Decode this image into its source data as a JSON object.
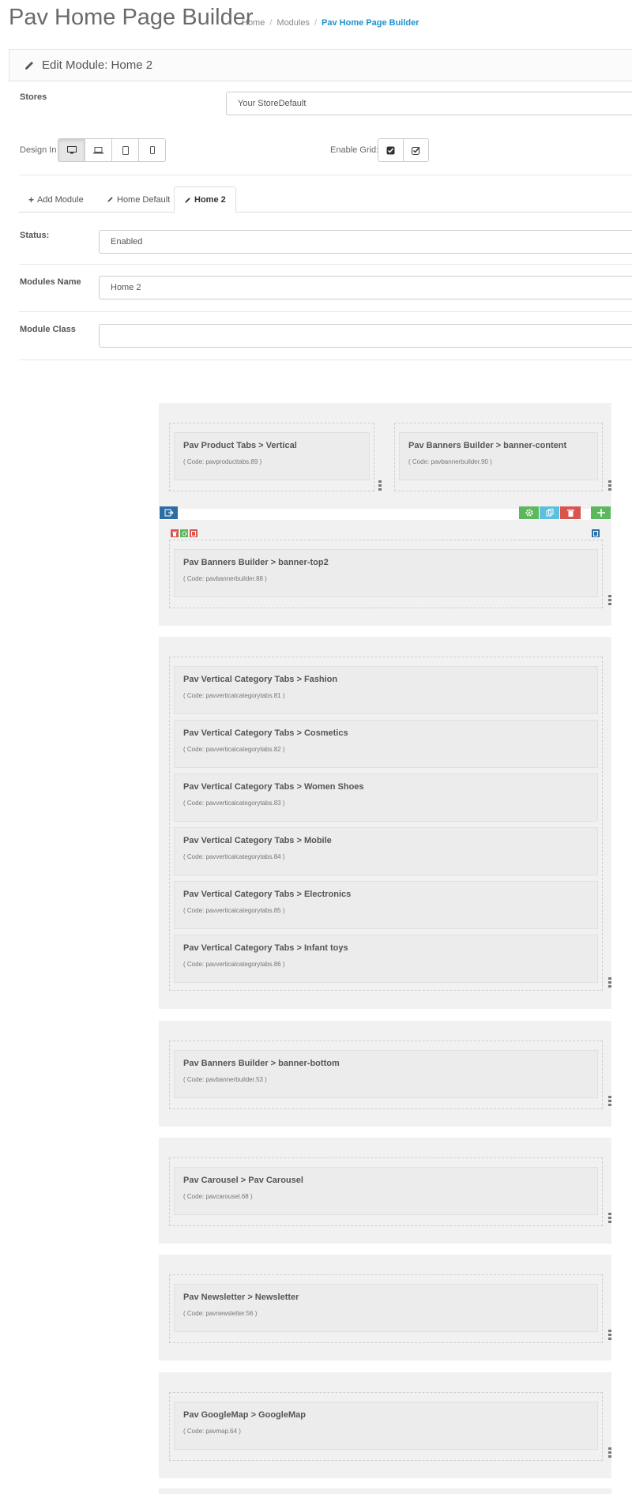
{
  "header": {
    "title": "Pav Home Page Builder",
    "breadcrumb": [
      "Home",
      "Modules",
      "Pav Home Page Builder"
    ]
  },
  "panel": {
    "title": "Edit Module: Home 2"
  },
  "form": {
    "stores_label": "Stores",
    "stores_value": "Your StoreDefault",
    "design_in_label": "Design In",
    "enable_grid_label": "Enable Grid:"
  },
  "tabs": [
    {
      "label": "Add Module",
      "icon": "plus-icon"
    },
    {
      "label": "Home Default",
      "icon": "pencil-icon"
    },
    {
      "label": "Home 2",
      "icon": "pencil-icon",
      "active": true
    }
  ],
  "fields": {
    "status_label": "Status:",
    "status_value": "Enabled",
    "name_label": "Modules Name",
    "name_value": "Home 2",
    "class_label": "Module Class",
    "class_value": ""
  },
  "colors": {
    "accent": "#1e91cf",
    "green": "#5cb85c",
    "teal": "#5bc0de",
    "red": "#d9534f",
    "blue": "#2e6da4"
  },
  "layout_rows": [
    {
      "widgets": [
        {
          "name": "Pav Product Tabs > Vertical",
          "code": "( Code: pavproducttabs.89 )"
        },
        {
          "name": "Pav Banners Builder > banner-content",
          "code": "( Code: pavbannerbuilder.90 )"
        }
      ]
    },
    {
      "widgets": [
        {
          "name": "Pav Banners Builder > banner-top2",
          "code": "( Code: pavbannerbuilder.88 )"
        }
      ]
    },
    {
      "widgets": [
        {
          "name": "Pav Vertical Category Tabs > Fashion",
          "code": "( Code: pavverticalcategorytabs.81 )"
        },
        {
          "name": "Pav Vertical Category Tabs > Cosmetics",
          "code": "( Code: pavverticalcategorytabs.82 )"
        },
        {
          "name": "Pav Vertical Category Tabs > Women Shoes",
          "code": "( Code: pavverticalcategorytabs.83 )"
        },
        {
          "name": "Pav Vertical Category Tabs > Mobile",
          "code": "( Code: pavverticalcategorytabs.84 )"
        },
        {
          "name": "Pav Vertical Category Tabs > Electronics",
          "code": "( Code: pavverticalcategorytabs.85 )"
        },
        {
          "name": "Pav Vertical Category Tabs > Infant toys",
          "code": "( Code: pavverticalcategorytabs.86 )"
        }
      ]
    },
    {
      "widgets": [
        {
          "name": "Pav Banners Builder > banner-bottom",
          "code": "( Code: pavbannerbuilder.53 )"
        }
      ]
    },
    {
      "widgets": [
        {
          "name": "Pav Carousel > Pav Carousel",
          "code": "( Code: pavcarousel.68 )"
        }
      ]
    },
    {
      "widgets": [
        {
          "name": "Pav Newsletter > Newsletter",
          "code": "( Code: pavnewsletter.56 )"
        }
      ]
    },
    {
      "widgets": [
        {
          "name": "Pav GoogleMap > GoogleMap",
          "code": "( Code: pavmap.64 )"
        }
      ]
    }
  ]
}
